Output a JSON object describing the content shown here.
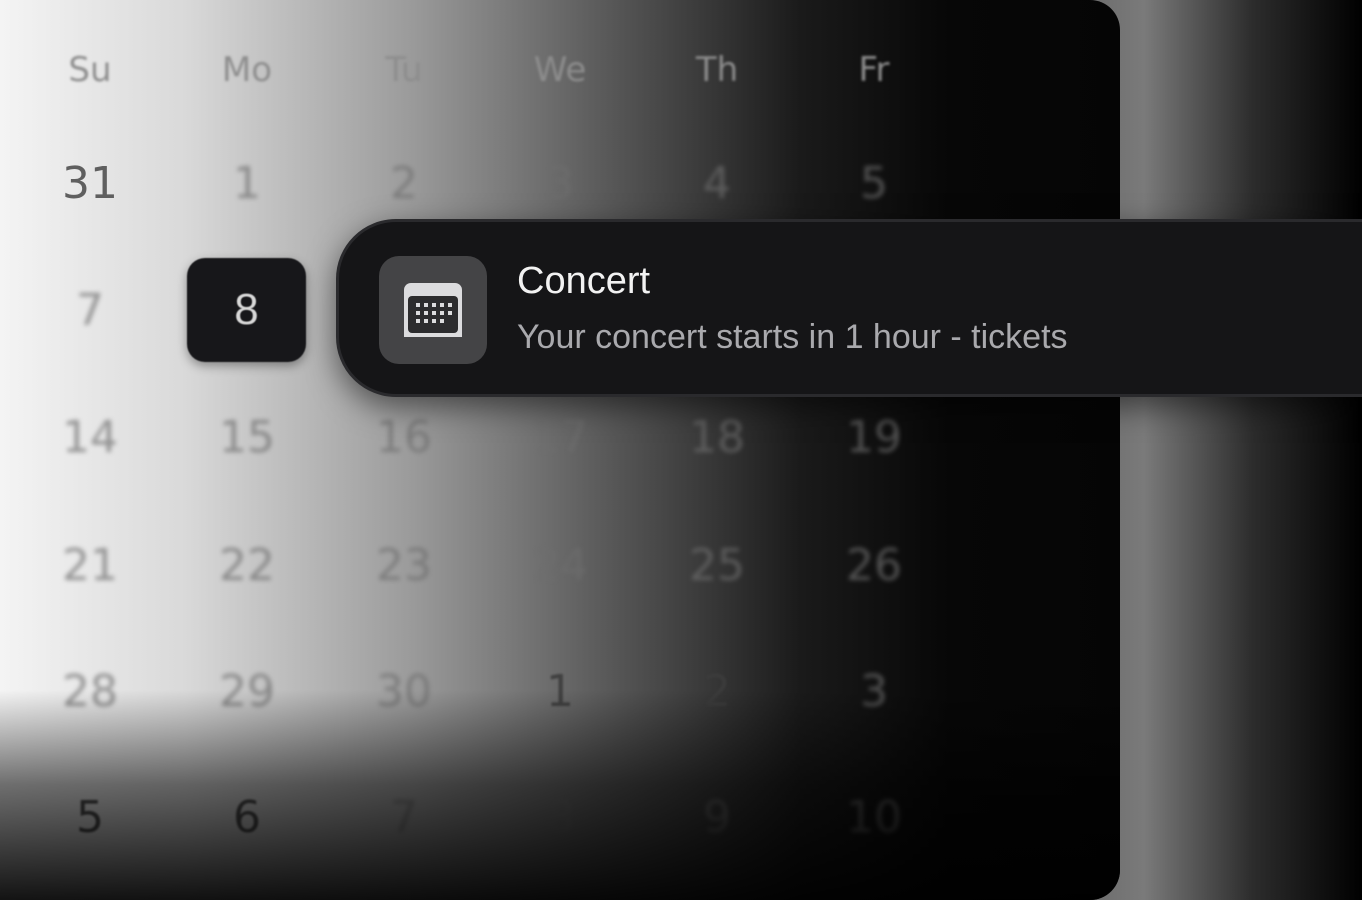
{
  "calendar": {
    "weekdays": [
      "Su",
      "Mo",
      "Tu",
      "We",
      "Th",
      "Fr"
    ],
    "weeks": [
      [
        "31",
        "1",
        "2",
        "3",
        "4",
        "5"
      ],
      [
        "7",
        "8",
        "",
        "",
        "",
        ""
      ],
      [
        "14",
        "15",
        "16",
        "17",
        "18",
        "19"
      ],
      [
        "21",
        "22",
        "23",
        "24",
        "25",
        "26"
      ],
      [
        "28",
        "29",
        "30",
        "1",
        "2",
        "3"
      ],
      [
        "5",
        "6",
        "7",
        "8",
        "9",
        "10"
      ]
    ],
    "selected_day": "8"
  },
  "notification": {
    "title": "Concert",
    "body": "Your concert starts in 1 hour - tickets",
    "icon": "calendar-icon"
  }
}
